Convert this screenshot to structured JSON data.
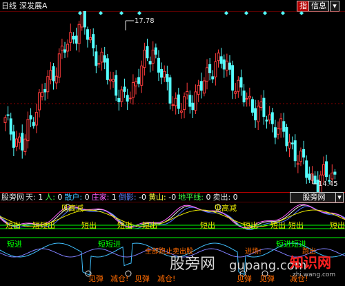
{
  "header": {
    "period": "日线",
    "stock_name": "深发展A",
    "buttons": [
      "指",
      "信息"
    ]
  },
  "main_chart": {
    "high_label": "17.78",
    "low_label": "14.45"
  },
  "indicator": {
    "name": "股旁网",
    "fields": [
      {
        "label": "天:",
        "value": "1",
        "label_color": "#c8c8c8",
        "value_color": "#ffffff"
      },
      {
        "label": "人:",
        "value": "0",
        "label_color": "#40ff40",
        "value_color": "#ffffff"
      },
      {
        "label": "散户:",
        "value": "0",
        "label_color": "#40c0ff",
        "value_color": "#ffffff"
      },
      {
        "label": "庄家:",
        "value": "1",
        "label_color": "#ff60ff",
        "value_color": "#ffffff"
      },
      {
        "label": "倒影:",
        "value": "-0",
        "label_color": "#6080ff",
        "value_color": "#ffffff"
      },
      {
        "label": "黄山:",
        "value": "-0",
        "label_color": "#ffff40",
        "value_color": "#ffffff"
      },
      {
        "label": "地平线:",
        "value": "0",
        "label_color": "#40ff40",
        "value_color": "#ffffff"
      },
      {
        "label": "卖出:",
        "value": "0",
        "label_color": "#e0e0e0",
        "value_color": "#ffffff"
      }
    ],
    "panel_tab": "股旁网"
  },
  "signals": {
    "sell_labels": [
      "短出",
      "短短出",
      "短出",
      "短出",
      "短出",
      "短出",
      "短出",
      "短出",
      "短出",
      "短出"
    ],
    "peak_labels": [
      "见高减",
      "见高减"
    ],
    "entry_labels": [
      "短进",
      "短短进",
      "短进短进"
    ],
    "bottom_labels": [
      "见弹",
      "减仓!",
      "见弹",
      "减仓!",
      "见弹",
      "见弹",
      "减仓!"
    ],
    "misc_labels": [
      "全部跑止卖出股",
      "进场!",
      "跑出"
    ]
  },
  "watermarks": {
    "cn": "股旁网",
    "url": "gupang.com",
    "badge": "知识网",
    "badge_sub": "zhi.wang.com"
  },
  "colors": {
    "up": "#ff3c3c",
    "down": "#54ffff",
    "diamond": "#54ffff",
    "line_white": "#e8e8e8",
    "line_blue": "#5070ff",
    "line_magenta": "#ff60ff",
    "line_yellow": "#e8e800",
    "line_green": "#00ff00",
    "line_cyan": "#40c0ff",
    "signal_sell": "#e8e800",
    "signal_bottom": "#ff6a00",
    "signal_entry": "#00ff00"
  }
}
